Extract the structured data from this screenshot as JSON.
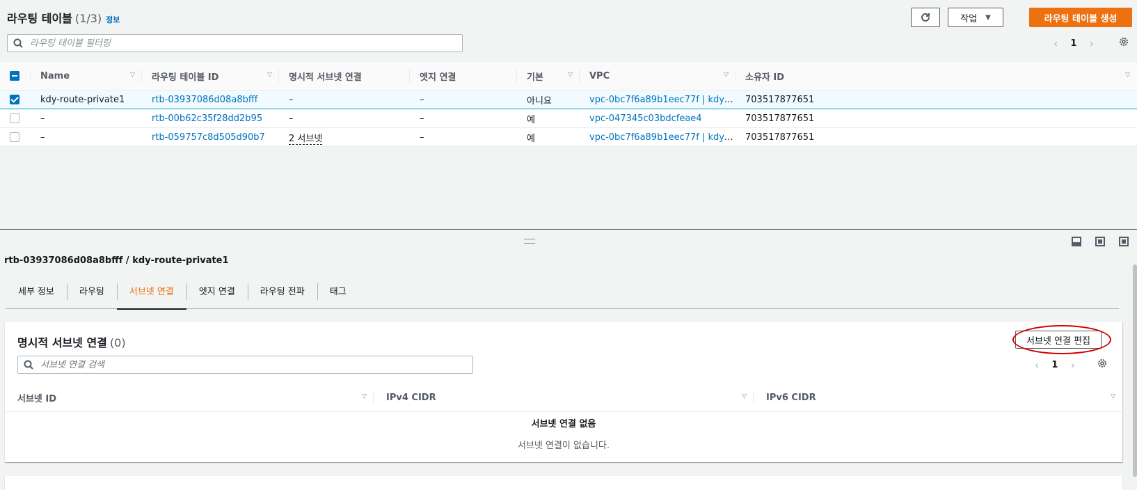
{
  "header": {
    "title": "라우팅 테이블",
    "count": "(1/3)",
    "info": "정보",
    "actions_label": "작업",
    "create_label": "라우팅 테이블 생성"
  },
  "filter": {
    "placeholder": "라우팅 테이블 필터링"
  },
  "pagination": {
    "page": "1"
  },
  "columns": [
    "Name",
    "라우팅 테이블 ID",
    "명시적 서브넷 연결",
    "엣지 연결",
    "기본",
    "VPC",
    "소유자 ID"
  ],
  "rows": [
    {
      "name": "kdy-route-private1",
      "id": "rtb-03937086d08a8bfff",
      "subnet": "–",
      "edge": "–",
      "main": "아니요",
      "vpc": "vpc-0bc7f6a89b1eec77f | kdy-…",
      "owner": "703517877651"
    },
    {
      "name": "–",
      "id": "rtb-00b62c35f28dd2b95",
      "subnet": "–",
      "edge": "–",
      "main": "예",
      "vpc": "vpc-047345c03bdcfeae4",
      "owner": "703517877651"
    },
    {
      "name": "–",
      "id": "rtb-059757c8d505d90b7",
      "subnet": "2 서브넷",
      "edge": "–",
      "main": "예",
      "vpc": "vpc-0bc7f6a89b1eec77f | kdy-…",
      "owner": "703517877651"
    }
  ],
  "detail": {
    "title": "rtb-03937086d08a8bfff / kdy-route-private1",
    "tabs": [
      "세부 정보",
      "라우팅",
      "서브넷 연결",
      "엣지 연결",
      "라우팅 전파",
      "태그"
    ],
    "active_tab": "서브넷 연결"
  },
  "subnet_card": {
    "title": "명시적 서브넷 연결",
    "count": "(0)",
    "edit_label": "서브넷 연결 편집",
    "search_placeholder": "서브넷 연결 검색",
    "page": "1",
    "columns": [
      "서브넷 ID",
      "IPv4 CIDR",
      "IPv6 CIDR"
    ],
    "empty_title": "서브넷 연결 없음",
    "empty_desc": "서브넷 연결이 없습니다."
  },
  "colors": {
    "accent": "#ec7211",
    "link": "#0073bb",
    "selected_row": "#f1faff",
    "annotation": "#d40000"
  },
  "icons": [
    "refresh-icon",
    "caret-down-icon",
    "search-icon",
    "chevron-left-icon",
    "chevron-right-icon",
    "gear-icon",
    "sort-icon",
    "panel-layout-icon"
  ]
}
